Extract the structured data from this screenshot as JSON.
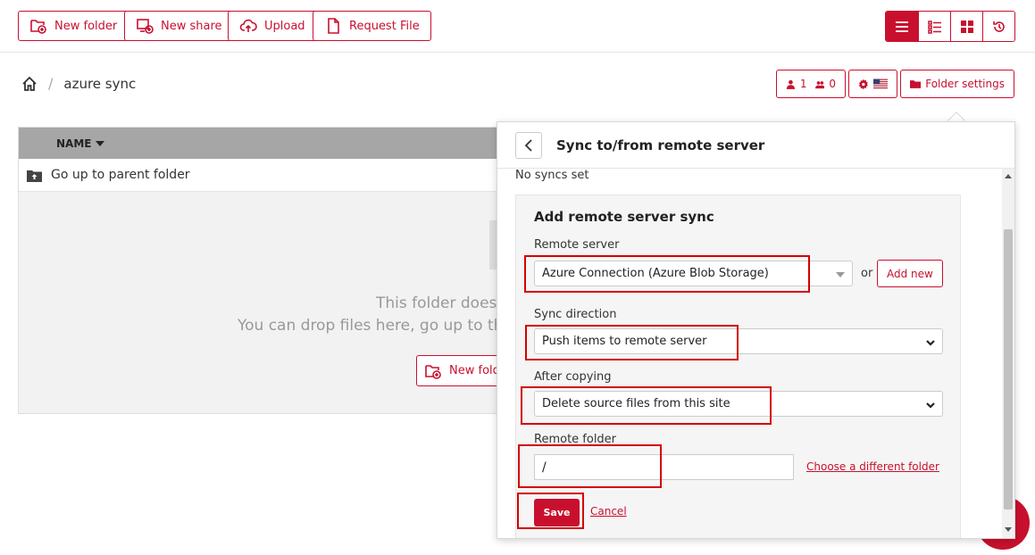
{
  "toolbar": {
    "new_folder": "New folder",
    "new_share": "New share",
    "upload": "Upload",
    "request_file": "Request File"
  },
  "view_modes": [
    "list-view-icon",
    "detail-list-icon",
    "grid-view-icon",
    "history-icon"
  ],
  "breadcrumb": {
    "current": "azure sync",
    "separator": "/"
  },
  "right_buttons": {
    "users_count": "1",
    "groups_count": "0",
    "folder_settings": "Folder settings"
  },
  "file_table": {
    "column_name": "NAME",
    "parent_row": "Go up to parent folder",
    "empty_line1": "This folder does",
    "empty_line2": "You can drop files here, go up to the",
    "empty_button": "New fold"
  },
  "sync_panel": {
    "title": "Sync to/from remote server",
    "no_syncs": "No syncs set",
    "form_title": "Add remote server sync",
    "remote_server_label": "Remote server",
    "remote_server_value": "Azure Connection (Azure Blob Storage)",
    "or_text": "or",
    "add_new": "Add new",
    "sync_direction_label": "Sync direction",
    "sync_direction_value": "Push items to remote server",
    "after_copying_label": "After copying",
    "after_copying_value": "Delete source files from this site",
    "remote_folder_label": "Remote folder",
    "remote_folder_value": "/",
    "choose_folder": "Choose a different folder",
    "save": "Save",
    "cancel": "Cancel"
  },
  "colors": {
    "accent": "#c8102e",
    "highlight": "#d40000"
  }
}
